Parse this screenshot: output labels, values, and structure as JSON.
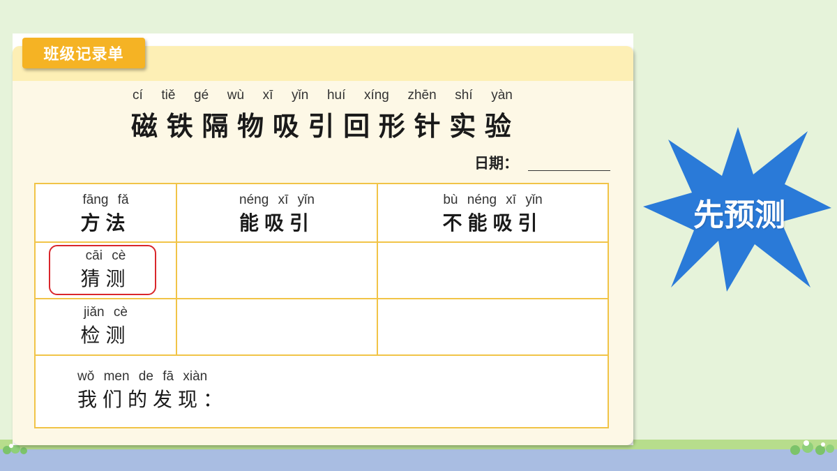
{
  "tag": "班级记录单",
  "title": {
    "pinyin": [
      "cí",
      "tiě",
      "gé",
      "wù",
      "xī",
      "yǐn",
      "huí",
      "xíng",
      "zhēn",
      "shí",
      "yàn"
    ],
    "chars": [
      "磁",
      "铁",
      "隔",
      "物",
      "吸",
      "引",
      "回",
      "形",
      "针",
      "实",
      "验"
    ]
  },
  "date_label": "日期：",
  "table": {
    "headers": [
      {
        "pinyin": "fāng fǎ",
        "hanzi": "方法"
      },
      {
        "pinyin": "néng xī yǐn",
        "hanzi": "能吸引"
      },
      {
        "pinyin": "bù néng xī yǐn",
        "hanzi": "不能吸引"
      }
    ],
    "rows": [
      {
        "pinyin": "cāi cè",
        "hanzi": "猜测"
      },
      {
        "pinyin": "jiǎn cè",
        "hanzi": "检测"
      }
    ],
    "findings": {
      "pinyin": "wǒ men de fā xiàn",
      "hanzi": "我们的发现："
    }
  },
  "badge": "先预测",
  "colors": {
    "tag": "#f5b324",
    "table_border": "#f1c447",
    "highlight": "#d9262b",
    "starburst": "#2a7ad8"
  }
}
